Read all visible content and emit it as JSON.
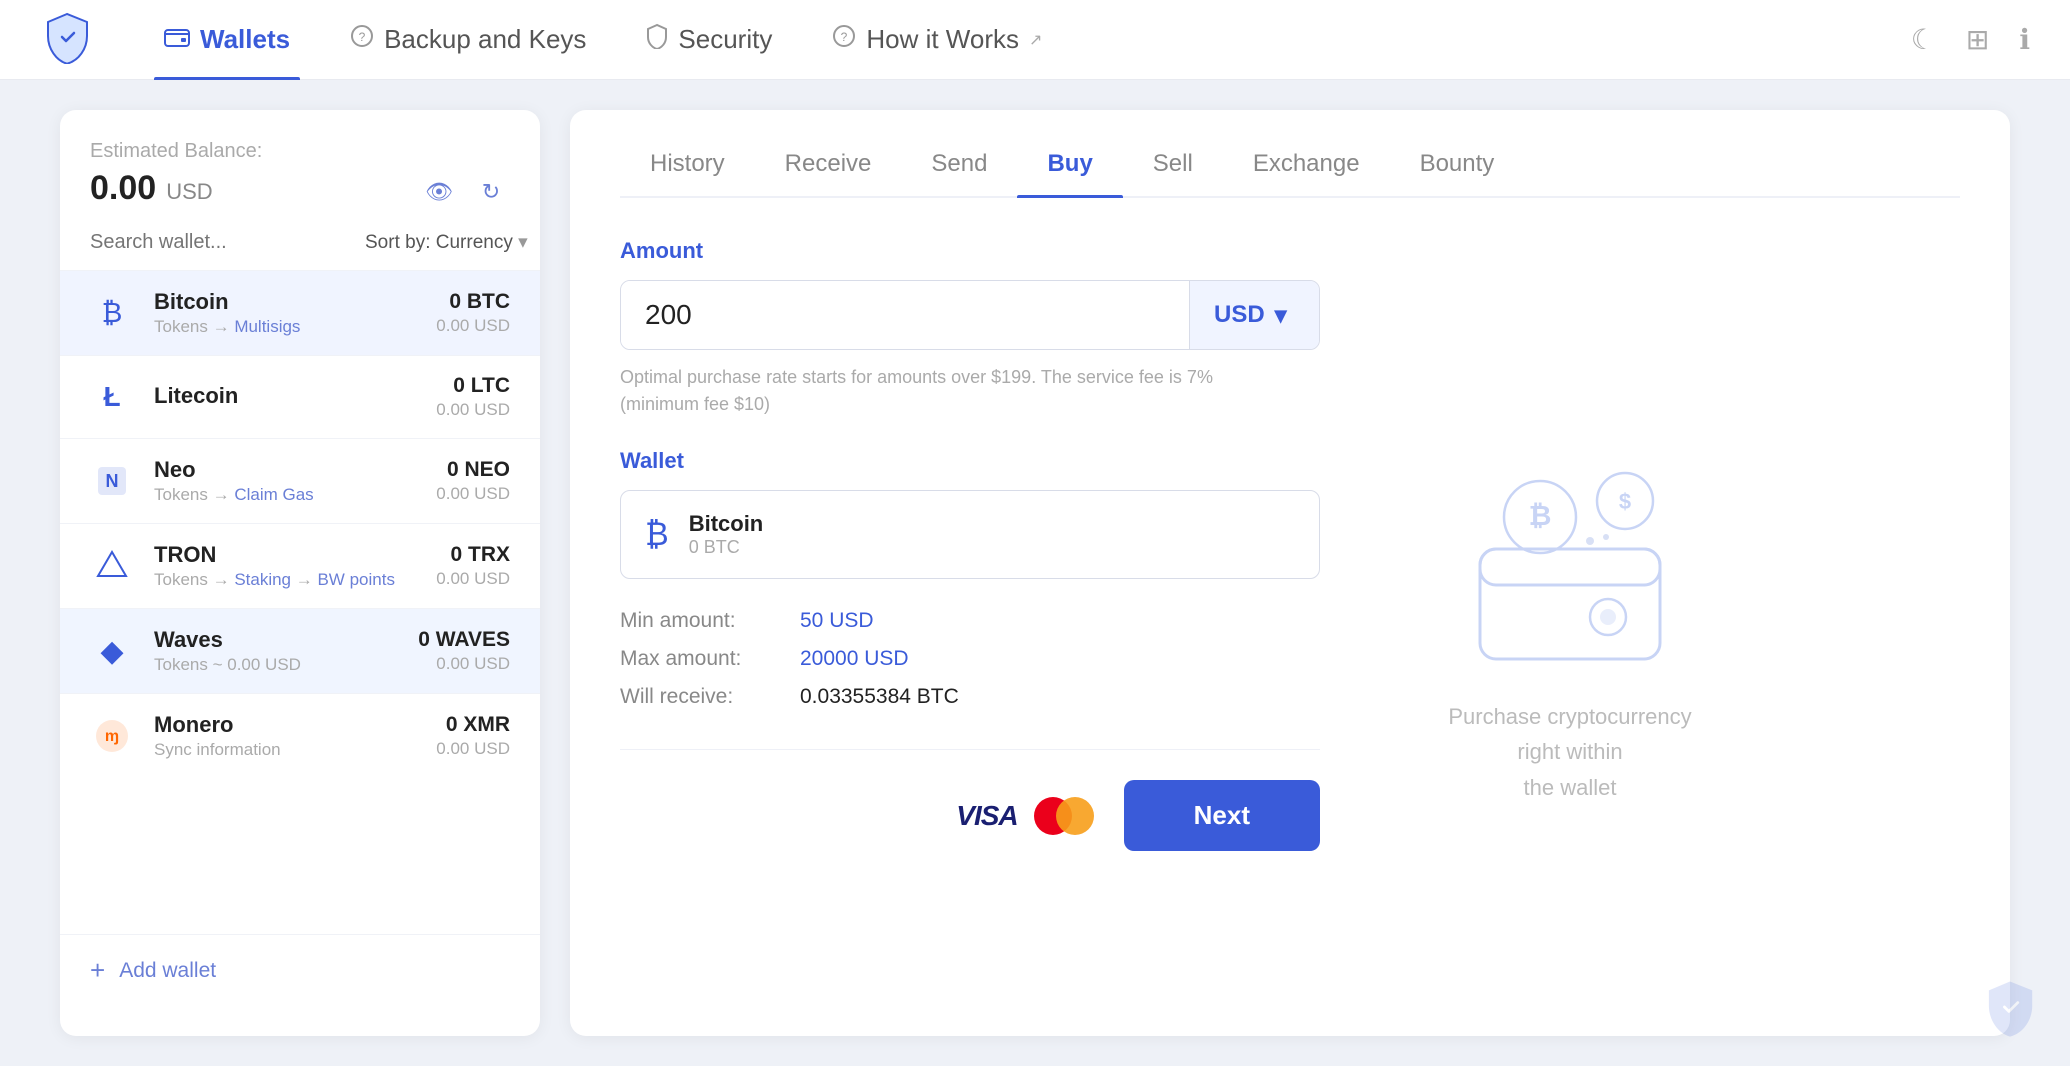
{
  "app": {
    "logo_alt": "Shield Logo"
  },
  "topnav": {
    "items": [
      {
        "id": "wallets",
        "label": "Wallets",
        "active": true
      },
      {
        "id": "backup",
        "label": "Backup and Keys",
        "active": false
      },
      {
        "id": "security",
        "label": "Security",
        "active": false
      },
      {
        "id": "how-it-works",
        "label": "How it Works",
        "active": false
      }
    ]
  },
  "sidebar": {
    "estimated_label": "Estimated Balance:",
    "balance": "0.00",
    "currency": "USD",
    "search_placeholder": "Search wallet...",
    "sort_label": "Sort by:",
    "sort_value": "Currency",
    "wallets": [
      {
        "name": "Bitcoin",
        "sub": "Tokens — Multisigs",
        "crypto": "0 BTC",
        "usd": "0.00 USD",
        "icon": "₿"
      },
      {
        "name": "Litecoin",
        "sub": "",
        "crypto": "0 LTC",
        "usd": "0.00 USD",
        "icon": "Ł"
      },
      {
        "name": "Neo",
        "sub": "Tokens — Claim Gas",
        "crypto": "0 NEO",
        "usd": "0.00 USD",
        "icon": "N"
      },
      {
        "name": "TRON",
        "sub": "Tokens — Staking — BW points",
        "crypto": "0 TRX",
        "usd": "0.00 USD",
        "icon": "T"
      },
      {
        "name": "Waves",
        "sub": "Tokens ~ 0.00 USD",
        "crypto": "0 WAVES",
        "usd": "0.00 USD",
        "icon": "◆"
      },
      {
        "name": "Monero",
        "sub": "Sync information",
        "crypto": "0 XMR",
        "usd": "0.00 USD",
        "icon": "ɱ"
      }
    ],
    "add_wallet_label": "Add wallet"
  },
  "tabs": [
    {
      "id": "history",
      "label": "History",
      "active": false
    },
    {
      "id": "receive",
      "label": "Receive",
      "active": false
    },
    {
      "id": "send",
      "label": "Send",
      "active": false
    },
    {
      "id": "buy",
      "label": "Buy",
      "active": true
    },
    {
      "id": "sell",
      "label": "Sell",
      "active": false
    },
    {
      "id": "exchange",
      "label": "Exchange",
      "active": false
    },
    {
      "id": "bounty",
      "label": "Bounty",
      "active": false
    }
  ],
  "buy": {
    "amount_label": "Amount",
    "amount_value": "200",
    "currency": "USD",
    "hint": "Optimal purchase rate starts for amounts over $199. The service fee is 7%\n(minimum fee $10)",
    "wallet_label": "Wallet",
    "selected_wallet_name": "Bitcoin",
    "selected_wallet_sub": "0 BTC",
    "min_label": "Min amount:",
    "min_value": "50 USD",
    "max_label": "Max amount:",
    "max_value": "20000 USD",
    "receive_label": "Will receive:",
    "receive_value": "0.03355384 BTC",
    "next_button": "Next",
    "illustration_text": "Purchase cryptocurrency right within\nthe wallet"
  }
}
